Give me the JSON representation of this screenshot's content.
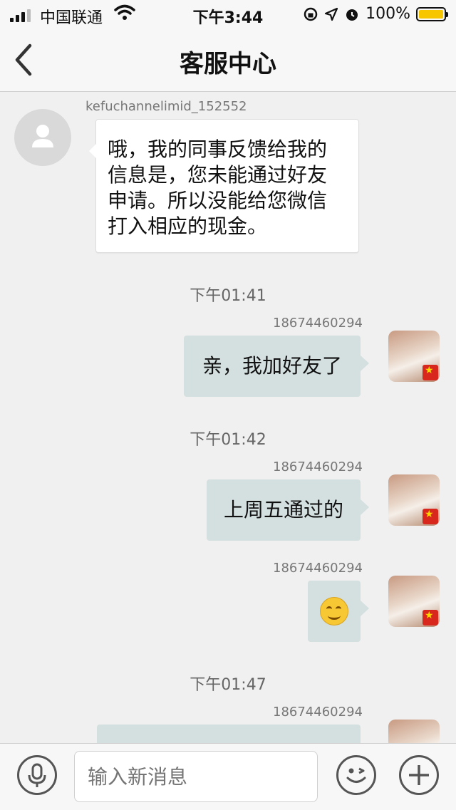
{
  "status_bar": {
    "carrier": "中国联通",
    "time": "下午3:44",
    "battery": "100%",
    "battery_level": 1.0
  },
  "nav": {
    "title": "客服中心",
    "back_icon": "chevron-left-icon"
  },
  "messages": [
    {
      "sender": "kefuchannelimid_152552",
      "lines": [
        "哦，我的同事反馈给我的",
        "信息是，您未能通过好友",
        "申请。所以没能给您微信",
        "打入相应的现金。"
      ]
    },
    {
      "time": "下午01:41",
      "sender": "18674460294",
      "text": "亲，我加好友了"
    },
    {
      "time": "下午01:42",
      "sender": "18674460294",
      "text": "上周五通过的"
    },
    {
      "sender": "18674460294",
      "emoji": "smiling-face-icon"
    },
    {
      "time": "下午01:47",
      "sender": "18674460294",
      "text": ""
    }
  ],
  "input_bar": {
    "placeholder": "输入新消息",
    "voice_icon": "microphone-icon",
    "emoji_icon": "wink-face-icon",
    "add_icon": "plus-icon"
  }
}
